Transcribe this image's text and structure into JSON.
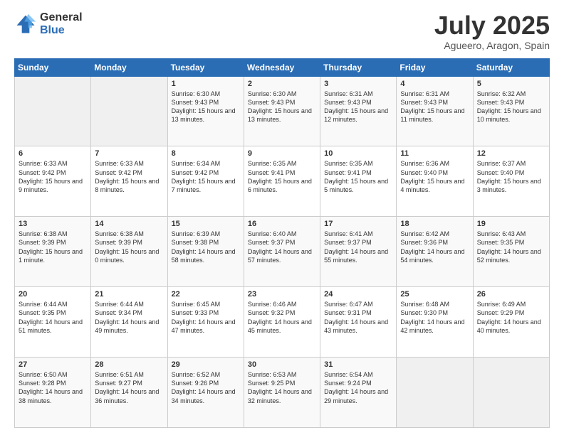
{
  "logo": {
    "general": "General",
    "blue": "Blue"
  },
  "header": {
    "month": "July 2025",
    "location": "Agueero, Aragon, Spain"
  },
  "weekdays": [
    "Sunday",
    "Monday",
    "Tuesday",
    "Wednesday",
    "Thursday",
    "Friday",
    "Saturday"
  ],
  "weeks": [
    [
      {
        "day": null,
        "sunrise": null,
        "sunset": null,
        "daylight": null
      },
      {
        "day": null,
        "sunrise": null,
        "sunset": null,
        "daylight": null
      },
      {
        "day": "1",
        "sunrise": "Sunrise: 6:30 AM",
        "sunset": "Sunset: 9:43 PM",
        "daylight": "Daylight: 15 hours and 13 minutes."
      },
      {
        "day": "2",
        "sunrise": "Sunrise: 6:30 AM",
        "sunset": "Sunset: 9:43 PM",
        "daylight": "Daylight: 15 hours and 13 minutes."
      },
      {
        "day": "3",
        "sunrise": "Sunrise: 6:31 AM",
        "sunset": "Sunset: 9:43 PM",
        "daylight": "Daylight: 15 hours and 12 minutes."
      },
      {
        "day": "4",
        "sunrise": "Sunrise: 6:31 AM",
        "sunset": "Sunset: 9:43 PM",
        "daylight": "Daylight: 15 hours and 11 minutes."
      },
      {
        "day": "5",
        "sunrise": "Sunrise: 6:32 AM",
        "sunset": "Sunset: 9:43 PM",
        "daylight": "Daylight: 15 hours and 10 minutes."
      }
    ],
    [
      {
        "day": "6",
        "sunrise": "Sunrise: 6:33 AM",
        "sunset": "Sunset: 9:42 PM",
        "daylight": "Daylight: 15 hours and 9 minutes."
      },
      {
        "day": "7",
        "sunrise": "Sunrise: 6:33 AM",
        "sunset": "Sunset: 9:42 PM",
        "daylight": "Daylight: 15 hours and 8 minutes."
      },
      {
        "day": "8",
        "sunrise": "Sunrise: 6:34 AM",
        "sunset": "Sunset: 9:42 PM",
        "daylight": "Daylight: 15 hours and 7 minutes."
      },
      {
        "day": "9",
        "sunrise": "Sunrise: 6:35 AM",
        "sunset": "Sunset: 9:41 PM",
        "daylight": "Daylight: 15 hours and 6 minutes."
      },
      {
        "day": "10",
        "sunrise": "Sunrise: 6:35 AM",
        "sunset": "Sunset: 9:41 PM",
        "daylight": "Daylight: 15 hours and 5 minutes."
      },
      {
        "day": "11",
        "sunrise": "Sunrise: 6:36 AM",
        "sunset": "Sunset: 9:40 PM",
        "daylight": "Daylight: 15 hours and 4 minutes."
      },
      {
        "day": "12",
        "sunrise": "Sunrise: 6:37 AM",
        "sunset": "Sunset: 9:40 PM",
        "daylight": "Daylight: 15 hours and 3 minutes."
      }
    ],
    [
      {
        "day": "13",
        "sunrise": "Sunrise: 6:38 AM",
        "sunset": "Sunset: 9:39 PM",
        "daylight": "Daylight: 15 hours and 1 minute."
      },
      {
        "day": "14",
        "sunrise": "Sunrise: 6:38 AM",
        "sunset": "Sunset: 9:39 PM",
        "daylight": "Daylight: 15 hours and 0 minutes."
      },
      {
        "day": "15",
        "sunrise": "Sunrise: 6:39 AM",
        "sunset": "Sunset: 9:38 PM",
        "daylight": "Daylight: 14 hours and 58 minutes."
      },
      {
        "day": "16",
        "sunrise": "Sunrise: 6:40 AM",
        "sunset": "Sunset: 9:37 PM",
        "daylight": "Daylight: 14 hours and 57 minutes."
      },
      {
        "day": "17",
        "sunrise": "Sunrise: 6:41 AM",
        "sunset": "Sunset: 9:37 PM",
        "daylight": "Daylight: 14 hours and 55 minutes."
      },
      {
        "day": "18",
        "sunrise": "Sunrise: 6:42 AM",
        "sunset": "Sunset: 9:36 PM",
        "daylight": "Daylight: 14 hours and 54 minutes."
      },
      {
        "day": "19",
        "sunrise": "Sunrise: 6:43 AM",
        "sunset": "Sunset: 9:35 PM",
        "daylight": "Daylight: 14 hours and 52 minutes."
      }
    ],
    [
      {
        "day": "20",
        "sunrise": "Sunrise: 6:44 AM",
        "sunset": "Sunset: 9:35 PM",
        "daylight": "Daylight: 14 hours and 51 minutes."
      },
      {
        "day": "21",
        "sunrise": "Sunrise: 6:44 AM",
        "sunset": "Sunset: 9:34 PM",
        "daylight": "Daylight: 14 hours and 49 minutes."
      },
      {
        "day": "22",
        "sunrise": "Sunrise: 6:45 AM",
        "sunset": "Sunset: 9:33 PM",
        "daylight": "Daylight: 14 hours and 47 minutes."
      },
      {
        "day": "23",
        "sunrise": "Sunrise: 6:46 AM",
        "sunset": "Sunset: 9:32 PM",
        "daylight": "Daylight: 14 hours and 45 minutes."
      },
      {
        "day": "24",
        "sunrise": "Sunrise: 6:47 AM",
        "sunset": "Sunset: 9:31 PM",
        "daylight": "Daylight: 14 hours and 43 minutes."
      },
      {
        "day": "25",
        "sunrise": "Sunrise: 6:48 AM",
        "sunset": "Sunset: 9:30 PM",
        "daylight": "Daylight: 14 hours and 42 minutes."
      },
      {
        "day": "26",
        "sunrise": "Sunrise: 6:49 AM",
        "sunset": "Sunset: 9:29 PM",
        "daylight": "Daylight: 14 hours and 40 minutes."
      }
    ],
    [
      {
        "day": "27",
        "sunrise": "Sunrise: 6:50 AM",
        "sunset": "Sunset: 9:28 PM",
        "daylight": "Daylight: 14 hours and 38 minutes."
      },
      {
        "day": "28",
        "sunrise": "Sunrise: 6:51 AM",
        "sunset": "Sunset: 9:27 PM",
        "daylight": "Daylight: 14 hours and 36 minutes."
      },
      {
        "day": "29",
        "sunrise": "Sunrise: 6:52 AM",
        "sunset": "Sunset: 9:26 PM",
        "daylight": "Daylight: 14 hours and 34 minutes."
      },
      {
        "day": "30",
        "sunrise": "Sunrise: 6:53 AM",
        "sunset": "Sunset: 9:25 PM",
        "daylight": "Daylight: 14 hours and 32 minutes."
      },
      {
        "day": "31",
        "sunrise": "Sunrise: 6:54 AM",
        "sunset": "Sunset: 9:24 PM",
        "daylight": "Daylight: 14 hours and 29 minutes."
      },
      {
        "day": null,
        "sunrise": null,
        "sunset": null,
        "daylight": null
      },
      {
        "day": null,
        "sunrise": null,
        "sunset": null,
        "daylight": null
      }
    ]
  ]
}
